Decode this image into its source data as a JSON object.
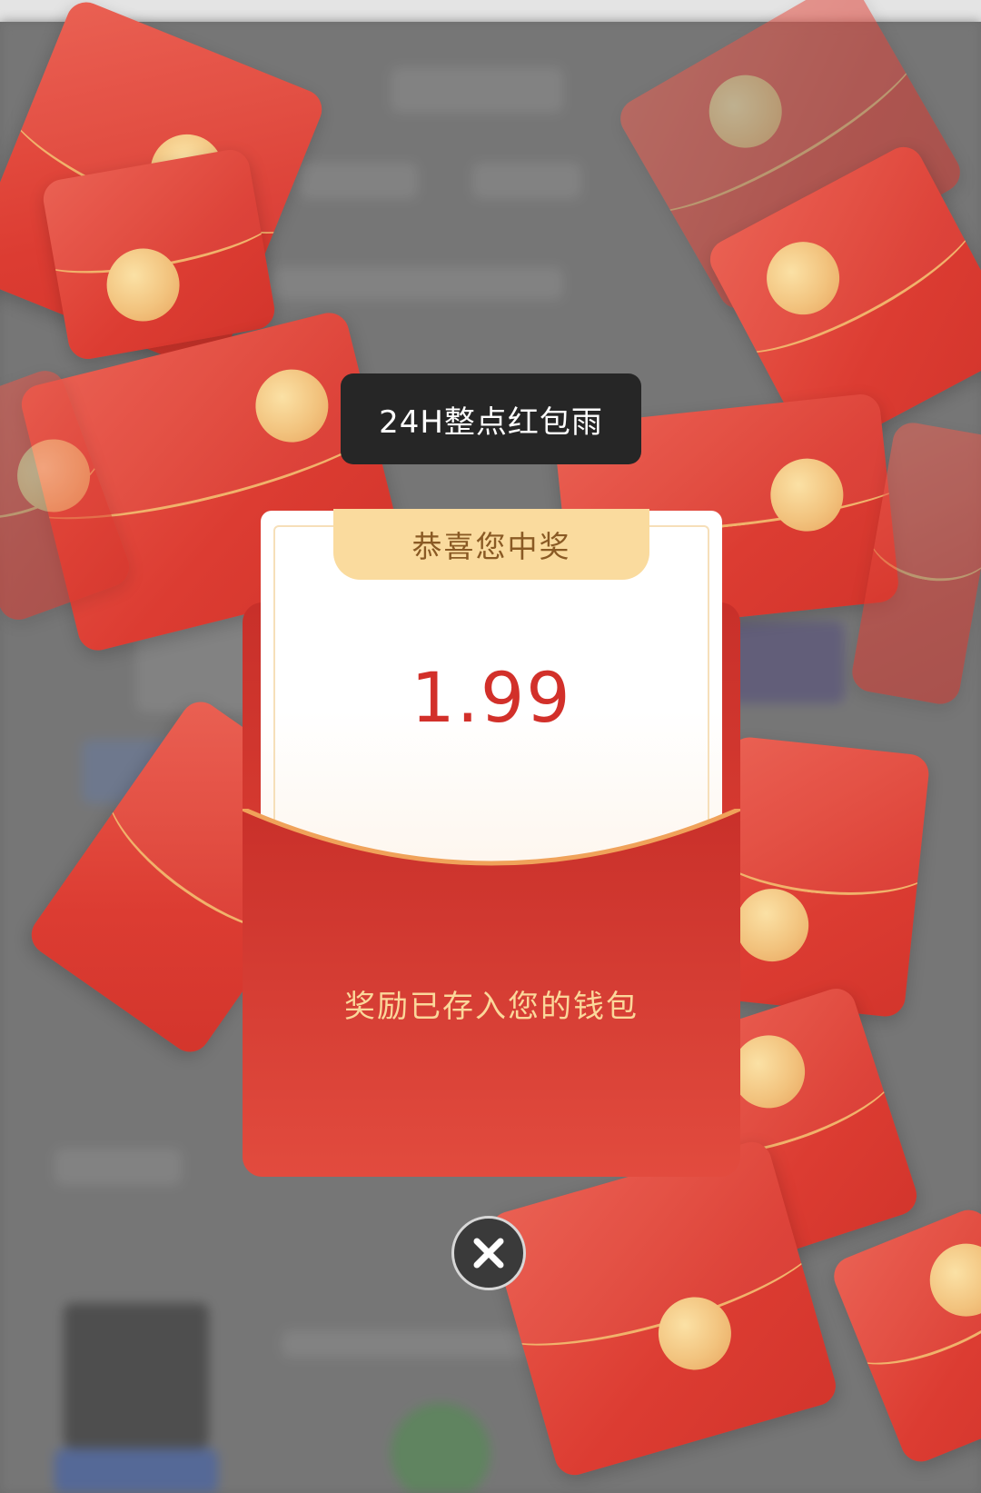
{
  "popup": {
    "event_title": "24H整点红包雨",
    "congrats_text": "恭喜您中奖",
    "amount": "1.99",
    "wallet_message": "奖励已存入您的钱包"
  },
  "icons": {
    "close": "close-icon",
    "envelope_seal": "seal-icon"
  },
  "colors": {
    "envelope_red": "#dc3c32",
    "seal_gold": "#f2c37e",
    "amount_red": "#d2302a",
    "tab_gold": "#fadb9e",
    "wallet_text": "#fbd79a"
  }
}
